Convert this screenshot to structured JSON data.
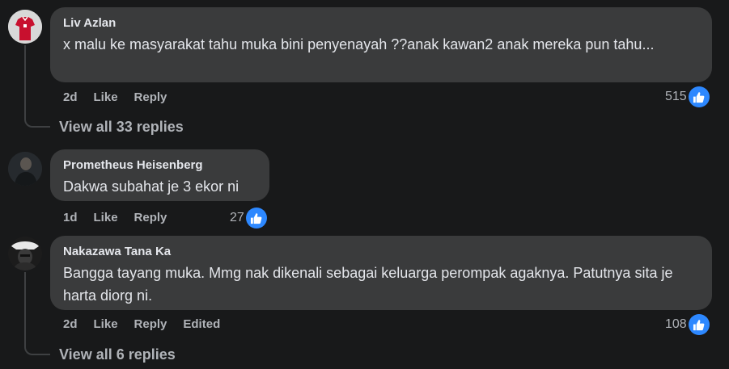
{
  "comments": [
    {
      "author": "Liv Azlan",
      "text": "x malu ke masyarakat tahu muka bini penyenayah ??anak kawan2 anak mereka pun tahu...",
      "time": "2d",
      "like": "Like",
      "reply": "Reply",
      "reaction_count": "515",
      "view_replies": "View all 33 replies"
    },
    {
      "author": "Prometheus Heisenberg",
      "text": "Dakwa subahat je 3 ekor ni",
      "time": "1d",
      "like": "Like",
      "reply": "Reply",
      "reaction_count": "27"
    },
    {
      "author": "Nakazawa Tana Ka",
      "text": "Bangga tayang muka. Mmg nak dikenali sebagai keluarga perompak agaknya. Patutnya sita je harta diorg ni.",
      "time": "2d",
      "like": "Like",
      "reply": "Reply",
      "edited": "Edited",
      "reaction_count": "108",
      "view_replies": "View all 6 replies"
    }
  ],
  "colors": {
    "background": "#18191a",
    "bubble": "#3a3b3c",
    "like_blue": "#2d88ff",
    "secondary_text": "#b0b3b8"
  },
  "icons": [
    "thumbs-up-icon"
  ]
}
